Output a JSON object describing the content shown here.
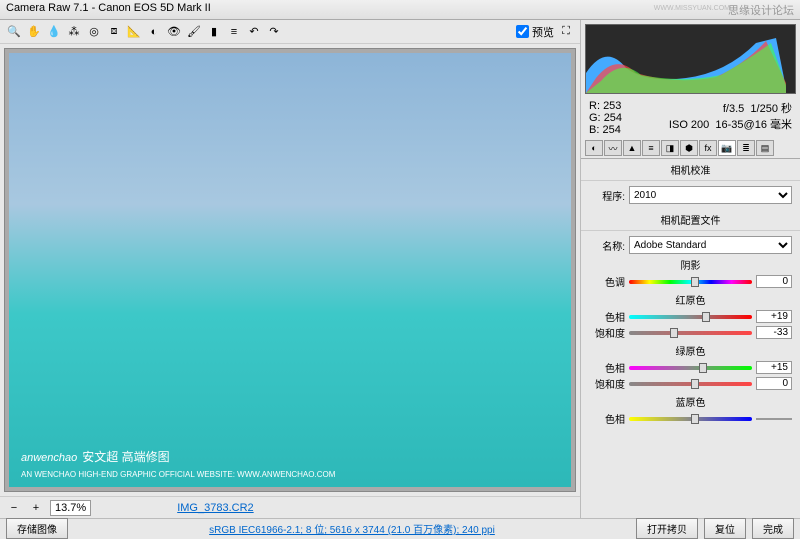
{
  "title": "Camera Raw 7.1 - Canon EOS 5D Mark II",
  "topWatermark": "思缘设计论坛",
  "topWatermarkUrl": "WWW.MISSYUAN.COM",
  "previewCheckbox": "预览",
  "rgb": {
    "rLabel": "R:",
    "r": "253",
    "gLabel": "G:",
    "g": "254",
    "bLabel": "B:",
    "b": "254"
  },
  "exif": {
    "aperture": "f/3.5",
    "shutter": "1/250 秒",
    "iso": "ISO 200",
    "focal": "16-35@16 毫米"
  },
  "panelTitle": "相机校准",
  "procLabel": "程序:",
  "procValue": "2010",
  "profileHeader": "相机配置文件",
  "nameLabel": "名称:",
  "nameValue": "Adobe Standard",
  "sections": {
    "shadow": "阴影",
    "red": "红原色",
    "green": "绿原色",
    "blue": "蓝原色"
  },
  "sliders": {
    "shadowTint": {
      "label": "色调",
      "value": "0"
    },
    "redHue": {
      "label": "色相",
      "value": "+19"
    },
    "redSat": {
      "label": "饱和度",
      "value": "-33"
    },
    "greenHue": {
      "label": "色相",
      "value": "+15"
    },
    "greenSat": {
      "label": "饱和度",
      "value": "0"
    },
    "blueHue": {
      "label": "色相",
      "value": ""
    }
  },
  "zoom": "13.7%",
  "filename": "IMG_3783.CR2",
  "saveBtn": "存储图像",
  "metaInfo": "sRGB IEC61966-2.1; 8 位; 5616 x 3744 (21.0 百万像素); 240 ppi",
  "btnOpen": "打开拷贝",
  "btnReset": "复位",
  "btnDone": "完成",
  "watermark": "anwenchao",
  "watermarkCn": "安文超 高端修图",
  "watermarkSub": "AN WENCHAO HIGH-END GRAPHIC OFFICIAL WEBSITE: WWW.ANWENCHAO.COM"
}
